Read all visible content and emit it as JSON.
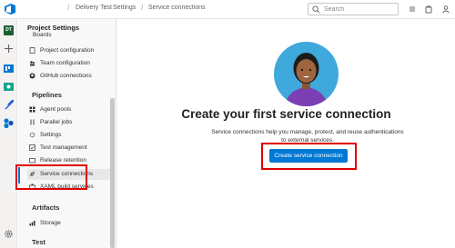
{
  "breadcrumbs": [
    "Delivery Test",
    "Settings",
    "Service connections"
  ],
  "search": {
    "placeholder": "Search"
  },
  "rail": {
    "project_badge": "DT"
  },
  "sidebar": {
    "title": "Project Settings",
    "truncated_section": "Boards",
    "boards_items": [
      {
        "label": "Project configuration",
        "icon": "doc-icon"
      },
      {
        "label": "Team configuration",
        "icon": "team-icon"
      },
      {
        "label": "GitHub connections",
        "icon": "github-icon"
      }
    ],
    "pipelines_section": "Pipelines",
    "pipelines_items": [
      {
        "label": "Agent pools",
        "icon": "pool-icon"
      },
      {
        "label": "Parallel jobs",
        "icon": "parallel-icon"
      },
      {
        "label": "Settings",
        "icon": "gear-icon"
      },
      {
        "label": "Test management",
        "icon": "test-icon"
      },
      {
        "label": "Release retention",
        "icon": "retention-icon"
      },
      {
        "label": "Service connections",
        "icon": "link-icon"
      },
      {
        "label": "XAML build services",
        "icon": "build-icon"
      }
    ],
    "artifacts_section": "Artifacts",
    "artifacts_items": [
      {
        "label": "Storage",
        "icon": "storage-icon"
      }
    ],
    "test_section": "Test"
  },
  "main": {
    "title": "Create your first service connection",
    "description": "Service connections help you manage, protect, and reuse authentications to external services.",
    "button_label": "Create service connection"
  },
  "colors": {
    "accent": "#0078d4",
    "highlight": "#e00000",
    "avatar_bg": "#3fa9dc",
    "shirt": "#7b3fb3"
  }
}
